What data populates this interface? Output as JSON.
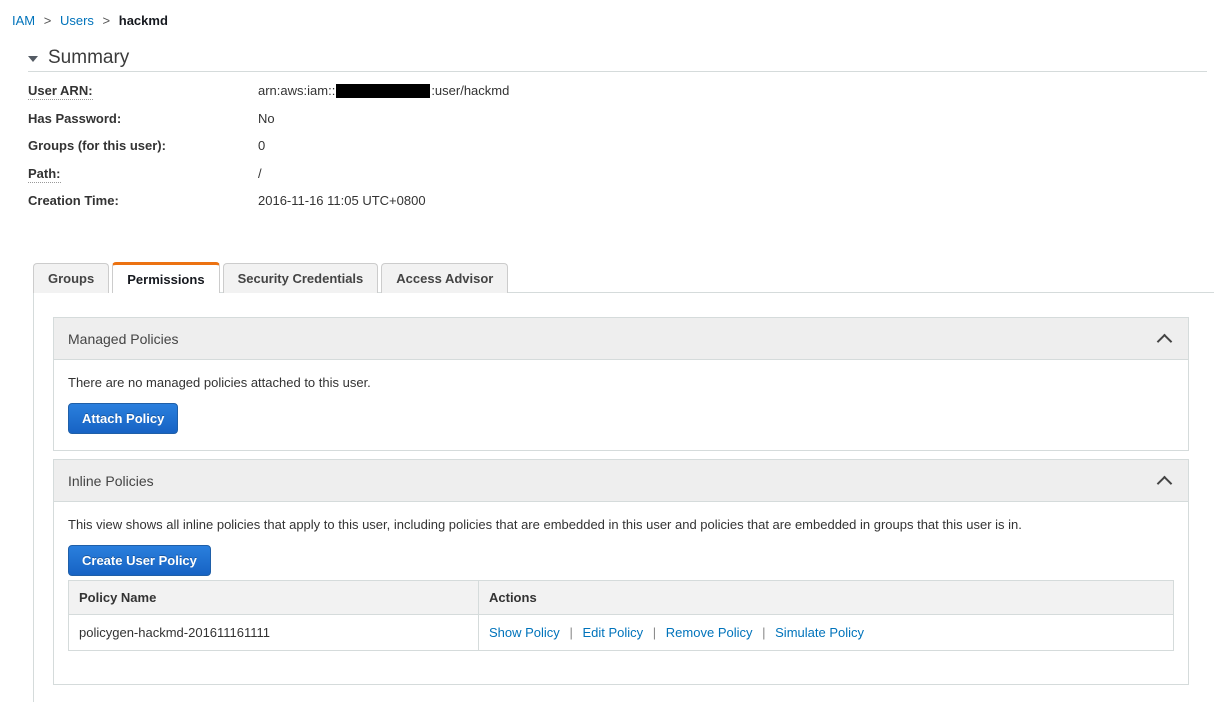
{
  "breadcrumb": {
    "items": [
      {
        "label": "IAM",
        "type": "link"
      },
      {
        "label": "Users",
        "type": "link"
      },
      {
        "label": "hackmd",
        "type": "current"
      }
    ],
    "separator": ">"
  },
  "summary": {
    "title": "Summary",
    "toggle_icon": "caret-down-icon",
    "rows": [
      {
        "label": "User ARN:",
        "hinted": true,
        "value_prefix": "arn:aws:iam::",
        "redacted": true,
        "value_suffix": ":user/hackmd"
      },
      {
        "label": "Has Password:",
        "hinted": false,
        "value": "No"
      },
      {
        "label": "Groups (for this user):",
        "hinted": false,
        "value": "0"
      },
      {
        "label": "Path:",
        "hinted": true,
        "value": "/"
      },
      {
        "label": "Creation Time:",
        "hinted": false,
        "value": "2016-11-16 11:05 UTC+0800"
      }
    ]
  },
  "tabs": [
    {
      "label": "Groups",
      "active": false
    },
    {
      "label": "Permissions",
      "active": true
    },
    {
      "label": "Security Credentials",
      "active": false
    },
    {
      "label": "Access Advisor",
      "active": false
    }
  ],
  "managed_policies": {
    "title": "Managed Policies",
    "collapse_icon": "chevron-up-icon",
    "empty_text": "There are no managed policies attached to this user.",
    "attach_button": "Attach Policy"
  },
  "inline_policies": {
    "title": "Inline Policies",
    "collapse_icon": "chevron-up-icon",
    "description": "This view shows all inline policies that apply to this user, including policies that are embedded in this user and policies that are embedded in groups that this user is in.",
    "create_button": "Create User Policy",
    "table": {
      "columns": [
        "Policy Name",
        "Actions"
      ],
      "rows": [
        {
          "name": "policygen-hackmd-201611161111",
          "actions": [
            "Show Policy",
            "Edit Policy",
            "Remove Policy",
            "Simulate Policy"
          ]
        }
      ],
      "action_separator": "|"
    }
  },
  "colors": {
    "link": "#0073bb",
    "active_tab_accent": "#ec7211",
    "button_blue": "#1763c4",
    "panel_header_bg": "#eeeeee",
    "border": "#d5dbdb"
  }
}
